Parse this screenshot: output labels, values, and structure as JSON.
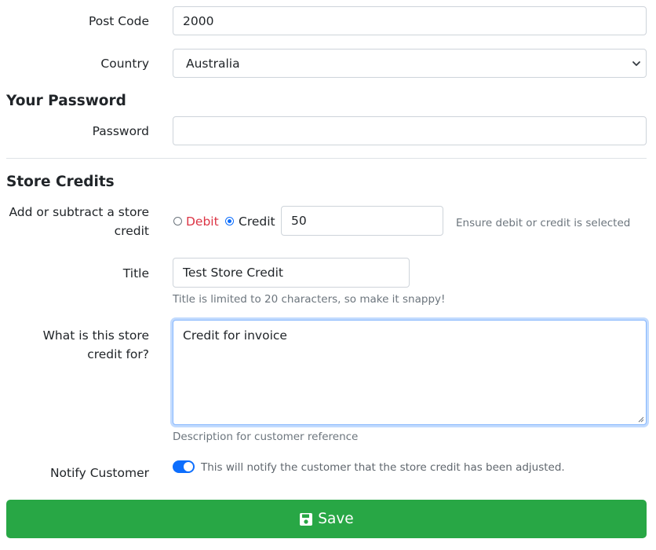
{
  "address": {
    "postcode_label": "Post Code",
    "postcode_value": "2000",
    "country_label": "Country",
    "country_value": "Australia"
  },
  "password_section": {
    "title": "Your Password",
    "password_label": "Password",
    "password_value": ""
  },
  "store_credits": {
    "title": "Store Credits",
    "adjust_label": "Add or subtract a store credit",
    "debit_label": "Debit",
    "credit_label": "Credit",
    "amount_value": "50",
    "adjust_help": "Ensure debit or credit is selected",
    "title_label": "Title",
    "title_value": "Test Store Credit",
    "title_help": "Title is limited to 20 characters, so make it snappy!",
    "description_label": "What is this store credit for?",
    "description_value": "Credit for invoice",
    "description_help": "Description for customer reference",
    "notify_label": "Notify Customer",
    "notify_help": "This will notify the customer that the store credit has been adjusted.",
    "notify_enabled": true,
    "selected_type": "Credit"
  },
  "actions": {
    "save_label": "Save"
  },
  "colors": {
    "save": "#28a745",
    "accent": "#0d6efd",
    "debit": "#dc3545"
  },
  "icons": {
    "save": "floppy-disk-icon",
    "country_select": "chevron-down-icon"
  }
}
